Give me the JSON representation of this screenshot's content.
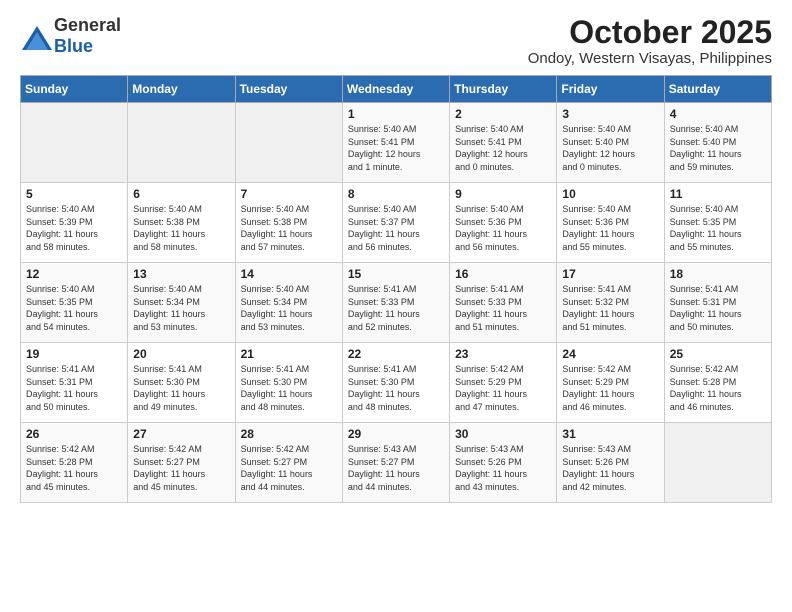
{
  "header": {
    "logo_general": "General",
    "logo_blue": "Blue",
    "month_title": "October 2025",
    "subtitle": "Ondoy, Western Visayas, Philippines"
  },
  "days_of_week": [
    "Sunday",
    "Monday",
    "Tuesday",
    "Wednesday",
    "Thursday",
    "Friday",
    "Saturday"
  ],
  "weeks": [
    [
      {
        "day": "",
        "info": ""
      },
      {
        "day": "",
        "info": ""
      },
      {
        "day": "",
        "info": ""
      },
      {
        "day": "1",
        "info": "Sunrise: 5:40 AM\nSunset: 5:41 PM\nDaylight: 12 hours\nand 1 minute."
      },
      {
        "day": "2",
        "info": "Sunrise: 5:40 AM\nSunset: 5:41 PM\nDaylight: 12 hours\nand 0 minutes."
      },
      {
        "day": "3",
        "info": "Sunrise: 5:40 AM\nSunset: 5:40 PM\nDaylight: 12 hours\nand 0 minutes."
      },
      {
        "day": "4",
        "info": "Sunrise: 5:40 AM\nSunset: 5:40 PM\nDaylight: 11 hours\nand 59 minutes."
      }
    ],
    [
      {
        "day": "5",
        "info": "Sunrise: 5:40 AM\nSunset: 5:39 PM\nDaylight: 11 hours\nand 58 minutes."
      },
      {
        "day": "6",
        "info": "Sunrise: 5:40 AM\nSunset: 5:38 PM\nDaylight: 11 hours\nand 58 minutes."
      },
      {
        "day": "7",
        "info": "Sunrise: 5:40 AM\nSunset: 5:38 PM\nDaylight: 11 hours\nand 57 minutes."
      },
      {
        "day": "8",
        "info": "Sunrise: 5:40 AM\nSunset: 5:37 PM\nDaylight: 11 hours\nand 56 minutes."
      },
      {
        "day": "9",
        "info": "Sunrise: 5:40 AM\nSunset: 5:36 PM\nDaylight: 11 hours\nand 56 minutes."
      },
      {
        "day": "10",
        "info": "Sunrise: 5:40 AM\nSunset: 5:36 PM\nDaylight: 11 hours\nand 55 minutes."
      },
      {
        "day": "11",
        "info": "Sunrise: 5:40 AM\nSunset: 5:35 PM\nDaylight: 11 hours\nand 55 minutes."
      }
    ],
    [
      {
        "day": "12",
        "info": "Sunrise: 5:40 AM\nSunset: 5:35 PM\nDaylight: 11 hours\nand 54 minutes."
      },
      {
        "day": "13",
        "info": "Sunrise: 5:40 AM\nSunset: 5:34 PM\nDaylight: 11 hours\nand 53 minutes."
      },
      {
        "day": "14",
        "info": "Sunrise: 5:40 AM\nSunset: 5:34 PM\nDaylight: 11 hours\nand 53 minutes."
      },
      {
        "day": "15",
        "info": "Sunrise: 5:41 AM\nSunset: 5:33 PM\nDaylight: 11 hours\nand 52 minutes."
      },
      {
        "day": "16",
        "info": "Sunrise: 5:41 AM\nSunset: 5:33 PM\nDaylight: 11 hours\nand 51 minutes."
      },
      {
        "day": "17",
        "info": "Sunrise: 5:41 AM\nSunset: 5:32 PM\nDaylight: 11 hours\nand 51 minutes."
      },
      {
        "day": "18",
        "info": "Sunrise: 5:41 AM\nSunset: 5:31 PM\nDaylight: 11 hours\nand 50 minutes."
      }
    ],
    [
      {
        "day": "19",
        "info": "Sunrise: 5:41 AM\nSunset: 5:31 PM\nDaylight: 11 hours\nand 50 minutes."
      },
      {
        "day": "20",
        "info": "Sunrise: 5:41 AM\nSunset: 5:30 PM\nDaylight: 11 hours\nand 49 minutes."
      },
      {
        "day": "21",
        "info": "Sunrise: 5:41 AM\nSunset: 5:30 PM\nDaylight: 11 hours\nand 48 minutes."
      },
      {
        "day": "22",
        "info": "Sunrise: 5:41 AM\nSunset: 5:30 PM\nDaylight: 11 hours\nand 48 minutes."
      },
      {
        "day": "23",
        "info": "Sunrise: 5:42 AM\nSunset: 5:29 PM\nDaylight: 11 hours\nand 47 minutes."
      },
      {
        "day": "24",
        "info": "Sunrise: 5:42 AM\nSunset: 5:29 PM\nDaylight: 11 hours\nand 46 minutes."
      },
      {
        "day": "25",
        "info": "Sunrise: 5:42 AM\nSunset: 5:28 PM\nDaylight: 11 hours\nand 46 minutes."
      }
    ],
    [
      {
        "day": "26",
        "info": "Sunrise: 5:42 AM\nSunset: 5:28 PM\nDaylight: 11 hours\nand 45 minutes."
      },
      {
        "day": "27",
        "info": "Sunrise: 5:42 AM\nSunset: 5:27 PM\nDaylight: 11 hours\nand 45 minutes."
      },
      {
        "day": "28",
        "info": "Sunrise: 5:42 AM\nSunset: 5:27 PM\nDaylight: 11 hours\nand 44 minutes."
      },
      {
        "day": "29",
        "info": "Sunrise: 5:43 AM\nSunset: 5:27 PM\nDaylight: 11 hours\nand 44 minutes."
      },
      {
        "day": "30",
        "info": "Sunrise: 5:43 AM\nSunset: 5:26 PM\nDaylight: 11 hours\nand 43 minutes."
      },
      {
        "day": "31",
        "info": "Sunrise: 5:43 AM\nSunset: 5:26 PM\nDaylight: 11 hours\nand 42 minutes."
      },
      {
        "day": "",
        "info": ""
      }
    ]
  ]
}
